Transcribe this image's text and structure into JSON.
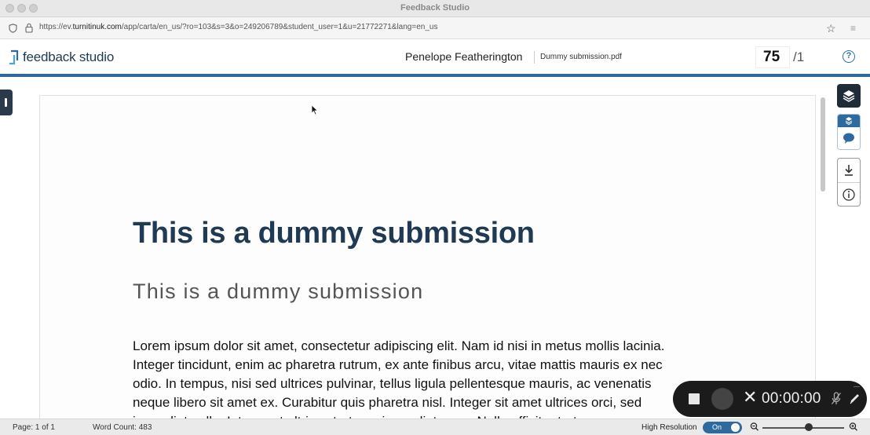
{
  "window": {
    "title": "Feedback Studio"
  },
  "browser": {
    "url_prefix": "https://ev.",
    "url_domain": "turnitinuk.com",
    "url_rest": "/app/carta/en_us/?ro=103&s=3&o=249206789&student_user=1&u=21772271&lang=en_us"
  },
  "header": {
    "logo_text": "feedback studio",
    "student_name": "Penelope Featherington",
    "file_name": "Dummy submission.pdf",
    "score": "75",
    "score_total": "/1",
    "help_symbol": "?"
  },
  "document": {
    "heading1": "This is a dummy submission",
    "heading2": "This is a dummy submission",
    "body_lines": [
      "Lorem ipsum dolor sit amet, consectetur adipiscing elit. Nam id nisi in metus mollis lacinia.",
      "Integer tincidunt, enim ac pharetra rutrum, ex ante finibus arcu, vitae mattis mauris ex nec",
      "odio. In tempus, nisi sed ultrices pulvinar, tellus ligula pellentesque mauris, ac venenatis",
      "neque libero sit amet ex. Curabitur quis pharetra nisl. Integer sit amet ultrices orci, sed",
      "imperdiet nulla. Integer at ultrices tortor, a imperdiet nunc. Nulla efficitur tortor"
    ]
  },
  "status": {
    "page": "Page: 1 of 1",
    "word_count": "Word Count: 483",
    "high_resolution_label": "High Resolution",
    "toggle_state": "On"
  },
  "recorder": {
    "timer": "00:00:00"
  },
  "colors": {
    "accent": "#2f6a9e",
    "heading": "#1f3a52",
    "dark_tool": "#1f2b36"
  }
}
